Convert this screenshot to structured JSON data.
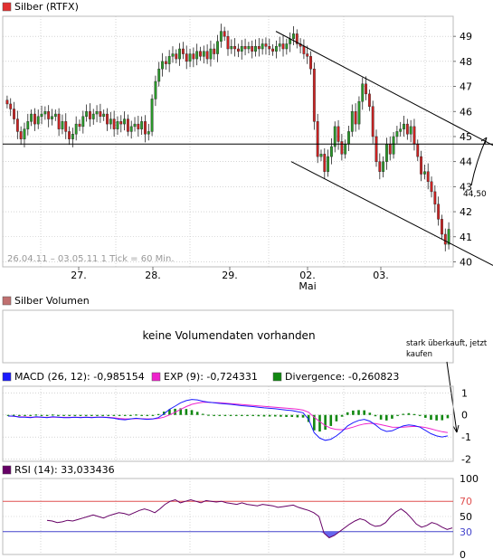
{
  "colors": {
    "price_legend": "#e23030",
    "volume_legend": "#c07070",
    "macd": "#1a1aff",
    "exp": "#ee22cc",
    "divergence": "#118811",
    "rsi": "#660066",
    "up_candle": "#2a9a2a",
    "down_candle": "#cc2222",
    "level70": "#e05050",
    "level30": "#4444cc",
    "rsi_fill": "#6666ee"
  },
  "price_panel": {
    "legend": "Silber (RTFX)",
    "info": "26.04.11 – 03.05.11   1 Tick = 60 Min.",
    "annotation_level": "44,50"
  },
  "date_axis": {
    "labels": [
      "27.",
      "28.",
      "29.",
      "02.",
      "03."
    ],
    "sub_label": "Mai"
  },
  "volume_panel": {
    "legend": "Silber Volumen",
    "message": "keine Volumendaten vorhanden",
    "note_line1": "stark überkauft, jetzt",
    "note_line2": "kaufen"
  },
  "macd_panel": {
    "macd_label": "MACD (26, 12): -0,985154",
    "exp_label": "EXP (9): -0,724331",
    "div_label": "Divergence: -0,260823"
  },
  "rsi_panel": {
    "label": "RSI (14): 33,033436"
  },
  "chart_data": [
    {
      "type": "candlestick",
      "title": "Silber (RTFX)",
      "x_axis": {
        "labels": [
          "27.",
          "28.",
          "29.",
          "02.",
          "03."
        ],
        "sub_label": "Mai"
      },
      "y_axis": {
        "ticks": [
          40,
          41,
          42,
          43,
          44,
          45,
          46,
          47,
          48,
          49
        ],
        "range": [
          39.8,
          49.8
        ]
      },
      "horizontal_line": 44.7,
      "annotation": "44,50",
      "channel_upper": [
        [
          0.0,
          49.2
        ],
        [
          1.0,
          44.65
        ]
      ],
      "channel_lower": [
        [
          0.0,
          44.0
        ],
        [
          1.0,
          40.0
        ]
      ],
      "close": [
        46.3,
        46.1,
        45.7,
        45.2,
        44.9,
        45.3,
        45.6,
        45.9,
        45.5,
        45.8,
        45.9,
        46.0,
        45.7,
        45.8,
        45.9,
        45.3,
        45.6,
        45.2,
        44.9,
        45.1,
        45.5,
        45.4,
        45.8,
        46.0,
        45.7,
        45.9,
        46.0,
        45.8,
        45.9,
        45.5,
        45.7,
        45.3,
        45.6,
        45.5,
        45.7,
        45.2,
        45.4,
        45.5,
        45.3,
        45.6,
        45.1,
        45.2,
        46.5,
        47.2,
        47.7,
        48.0,
        47.9,
        48.2,
        48.3,
        48.1,
        48.5,
        48.3,
        48.0,
        48.3,
        48.1,
        48.4,
        48.2,
        48.4,
        48.1,
        48.5,
        48.3,
        48.8,
        49.2,
        49.0,
        48.5,
        48.6,
        48.5,
        48.4,
        48.6,
        48.5,
        48.6,
        48.4,
        48.6,
        48.5,
        48.7,
        48.6,
        48.5,
        48.4,
        48.6,
        48.7,
        48.5,
        48.7,
        48.9,
        49.1,
        48.7,
        48.6,
        48.3,
        48.2,
        47.7,
        45.6,
        44.2,
        44.3,
        43.6,
        44.2,
        44.6,
        45.4,
        44.8,
        44.3,
        44.7,
        45.2,
        46.0,
        45.5,
        46.4,
        47.1,
        46.7,
        46.2,
        45.0,
        44.0,
        43.6,
        44.0,
        44.7,
        44.3,
        45.0,
        45.2,
        45.3,
        45.5,
        45.1,
        45.4,
        44.7,
        44.2,
        43.5,
        43.6,
        43.2,
        42.8,
        42.3,
        41.7,
        41.1,
        40.7,
        41.3
      ]
    },
    {
      "type": "line",
      "title": "MACD (26, 12): -0,985154",
      "y_axis": {
        "ticks": [
          1,
          0,
          -1,
          -2
        ],
        "range": [
          -2.1,
          1.3
        ]
      },
      "series": [
        {
          "name": "MACD (26, 12): -0,985154",
          "values": [
            -0.05,
            -0.05,
            -0.1,
            -0.1,
            -0.12,
            -0.08,
            -0.1,
            -0.12,
            -0.08,
            -0.1,
            -0.12,
            -0.12,
            -0.1,
            -0.12,
            -0.1,
            -0.12,
            -0.1,
            -0.1,
            -0.12,
            -0.15,
            -0.2,
            -0.22,
            -0.18,
            -0.15,
            -0.18,
            -0.2,
            -0.18,
            -0.12,
            0.05,
            0.25,
            0.4,
            0.55,
            0.65,
            0.7,
            0.68,
            0.62,
            0.58,
            0.55,
            0.52,
            0.5,
            0.48,
            0.45,
            0.42,
            0.4,
            0.38,
            0.35,
            0.32,
            0.3,
            0.28,
            0.25,
            0.22,
            0.2,
            0.15,
            0.1,
            -0.2,
            -0.8,
            -1.05,
            -1.15,
            -1.1,
            -0.95,
            -0.75,
            -0.5,
            -0.35,
            -0.25,
            -0.2,
            -0.28,
            -0.45,
            -0.65,
            -0.75,
            -0.72,
            -0.6,
            -0.5,
            -0.45,
            -0.48,
            -0.55,
            -0.7,
            -0.85,
            -0.95,
            -1.0,
            -0.95
          ]
        },
        {
          "name": "EXP (9): -0,724331",
          "values": [
            -0.05,
            -0.06,
            -0.08,
            -0.09,
            -0.1,
            -0.1,
            -0.1,
            -0.11,
            -0.1,
            -0.1,
            -0.11,
            -0.11,
            -0.1,
            -0.11,
            -0.1,
            -0.11,
            -0.1,
            -0.1,
            -0.11,
            -0.13,
            -0.16,
            -0.18,
            -0.18,
            -0.17,
            -0.17,
            -0.18,
            -0.18,
            -0.16,
            -0.1,
            0.0,
            0.12,
            0.25,
            0.38,
            0.48,
            0.54,
            0.57,
            0.57,
            0.56,
            0.55,
            0.53,
            0.51,
            0.49,
            0.47,
            0.45,
            0.43,
            0.41,
            0.39,
            0.37,
            0.35,
            0.33,
            0.31,
            0.29,
            0.26,
            0.22,
            0.12,
            -0.1,
            -0.3,
            -0.48,
            -0.6,
            -0.66,
            -0.67,
            -0.62,
            -0.55,
            -0.47,
            -0.41,
            -0.38,
            -0.39,
            -0.44,
            -0.5,
            -0.55,
            -0.56,
            -0.55,
            -0.53,
            -0.52,
            -0.53,
            -0.57,
            -0.63,
            -0.7,
            -0.76,
            -0.8
          ]
        },
        {
          "name": "Divergence: -0,260823",
          "type": "bar",
          "values": [
            0,
            0.01,
            -0.02,
            -0.01,
            -0.02,
            0.02,
            0,
            -0.01,
            0.02,
            0,
            -0.01,
            -0.01,
            0,
            -0.01,
            0,
            -0.01,
            0,
            0,
            -0.01,
            -0.02,
            -0.04,
            -0.04,
            0,
            0.02,
            -0.01,
            -0.02,
            0,
            0.04,
            0.15,
            0.25,
            0.28,
            0.3,
            0.27,
            0.22,
            0.14,
            0.05,
            0.01,
            -0.01,
            -0.03,
            -0.03,
            -0.03,
            -0.04,
            -0.05,
            -0.05,
            -0.05,
            -0.06,
            -0.07,
            -0.07,
            -0.07,
            -0.08,
            -0.09,
            -0.09,
            -0.11,
            -0.12,
            -0.32,
            -0.7,
            -0.75,
            -0.67,
            -0.5,
            -0.29,
            -0.08,
            0.12,
            0.2,
            0.22,
            0.21,
            0.1,
            -0.06,
            -0.21,
            -0.25,
            -0.17,
            -0.04,
            0.05,
            0.08,
            0.04,
            -0.02,
            -0.13,
            -0.22,
            -0.25,
            -0.24,
            -0.15
          ]
        }
      ]
    },
    {
      "type": "line",
      "title": "RSI (14): 33,033436",
      "y_axis": {
        "ticks": [
          100,
          70,
          50,
          30,
          0
        ],
        "range": [
          0,
          100
        ]
      },
      "levels": [
        70,
        30
      ],
      "series": [
        {
          "name": "RSI (14): 33,033436",
          "values": [
            45,
            44,
            42,
            43,
            45,
            44,
            46,
            48,
            50,
            52,
            50,
            48,
            51,
            53,
            55,
            54,
            52,
            55,
            58,
            60,
            58,
            55,
            60,
            66,
            70,
            72,
            68,
            70,
            72,
            70,
            68,
            71,
            70,
            69,
            70,
            68,
            67,
            66,
            68,
            66,
            65,
            64,
            66,
            65,
            64,
            62,
            63,
            64,
            65,
            62,
            60,
            58,
            55,
            50,
            28,
            22,
            25,
            30,
            35,
            40,
            44,
            47,
            45,
            40,
            37,
            38,
            42,
            50,
            56,
            60,
            55,
            48,
            40,
            36,
            38,
            42,
            40,
            36,
            33,
            35
          ]
        }
      ]
    }
  ]
}
